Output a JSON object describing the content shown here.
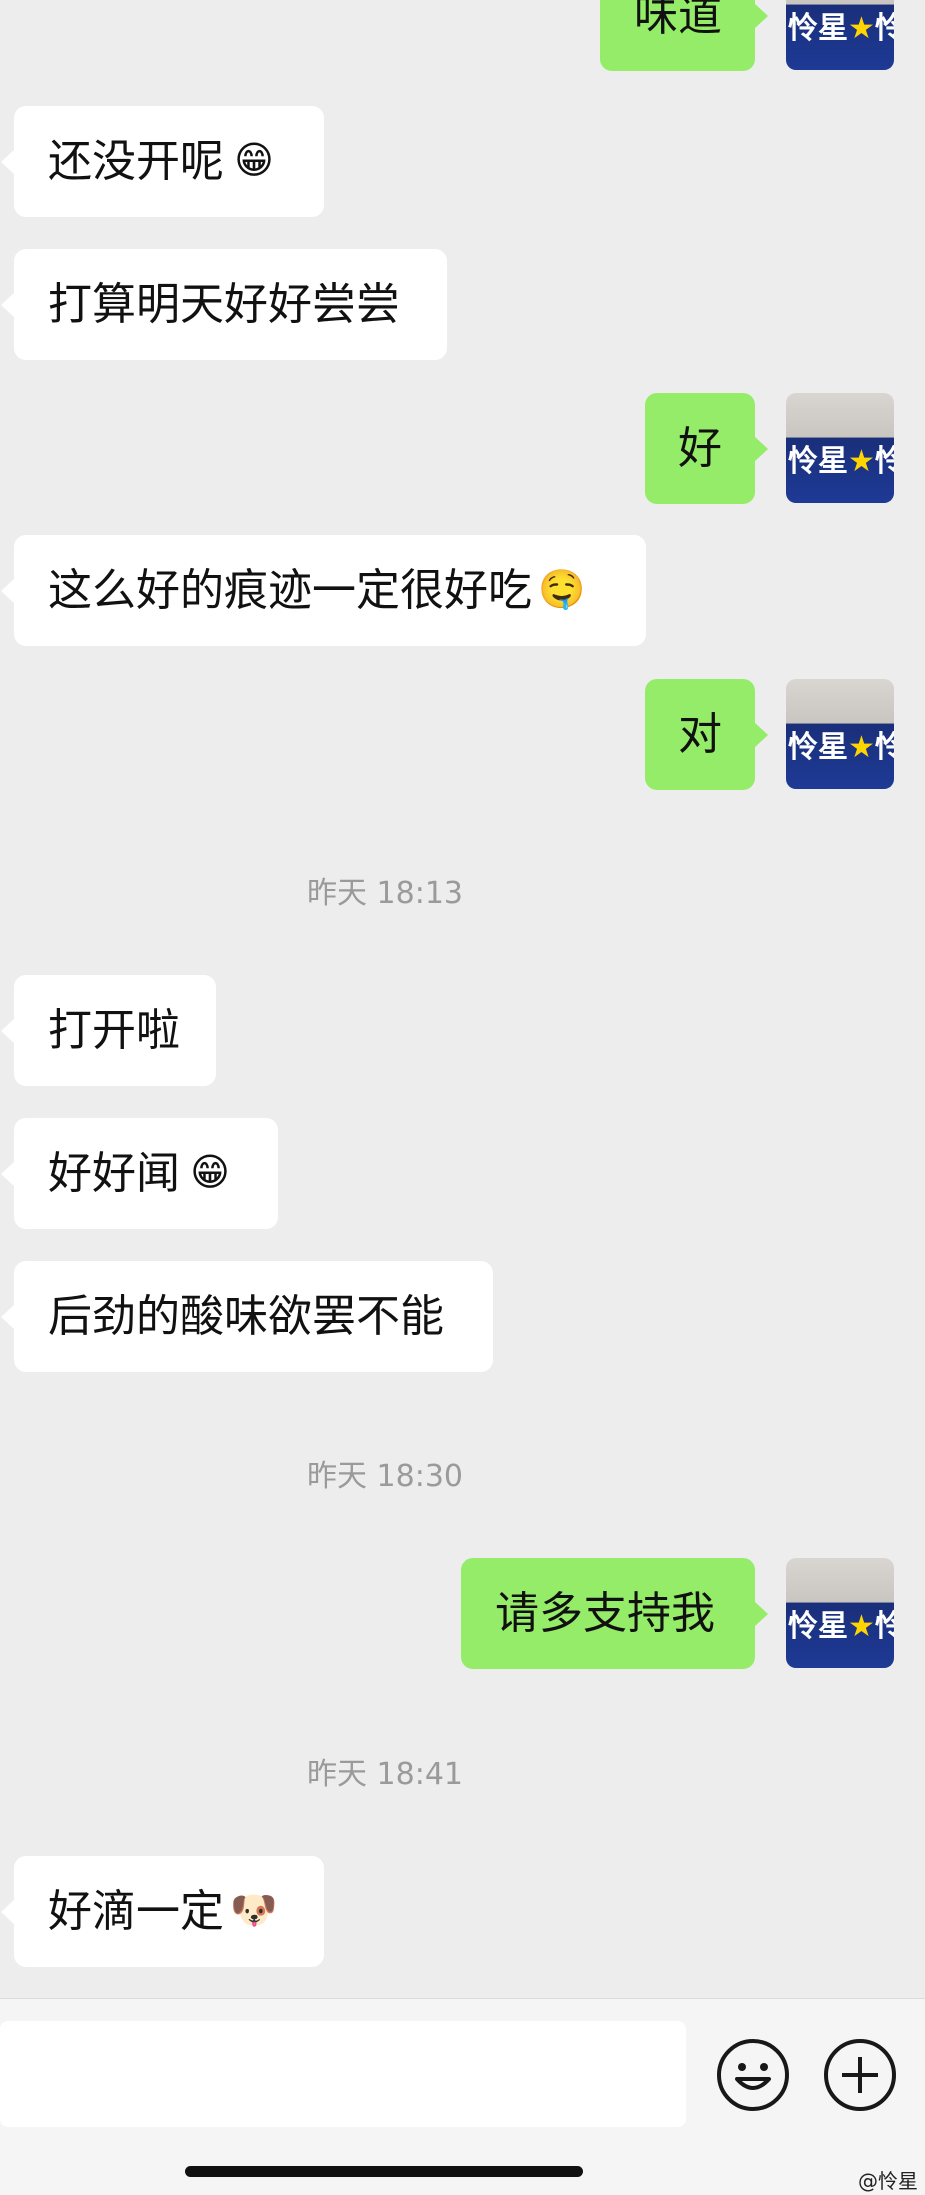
{
  "messages": [
    {
      "text": "味道",
      "side": "out"
    },
    {
      "text": "还没开呢",
      "emoji": "😁",
      "side": "in"
    },
    {
      "text": "打算明天好好尝尝",
      "side": "in"
    },
    {
      "text": "好",
      "side": "out"
    },
    {
      "text": "这么好的痕迹一定很好吃",
      "emoji": "🤤",
      "side": "in"
    },
    {
      "text": "对",
      "side": "out"
    },
    {
      "text": "打开啦",
      "side": "in"
    },
    {
      "text": "好好闻",
      "emoji": "😁",
      "side": "in"
    },
    {
      "text": "后劲的酸味欲罢不能",
      "side": "in"
    },
    {
      "text": "请多支持我",
      "side": "out"
    },
    {
      "text": "好滴一定",
      "emoji": "🐶",
      "side": "in"
    }
  ],
  "timestamps": [
    "昨天 18:13",
    "昨天 18:30",
    "昨天 18:41"
  ],
  "avatar": {
    "label": "怜星",
    "star": "★",
    "tail": "怜"
  },
  "input": {
    "placeholder": ""
  },
  "watermark": "@怜星",
  "colors": {
    "background": "#ededed",
    "incoming": "#ffffff",
    "outgoing": "#95ec69"
  },
  "icons": {
    "emoji_button": "smile-icon",
    "more_button": "plus-icon"
  }
}
